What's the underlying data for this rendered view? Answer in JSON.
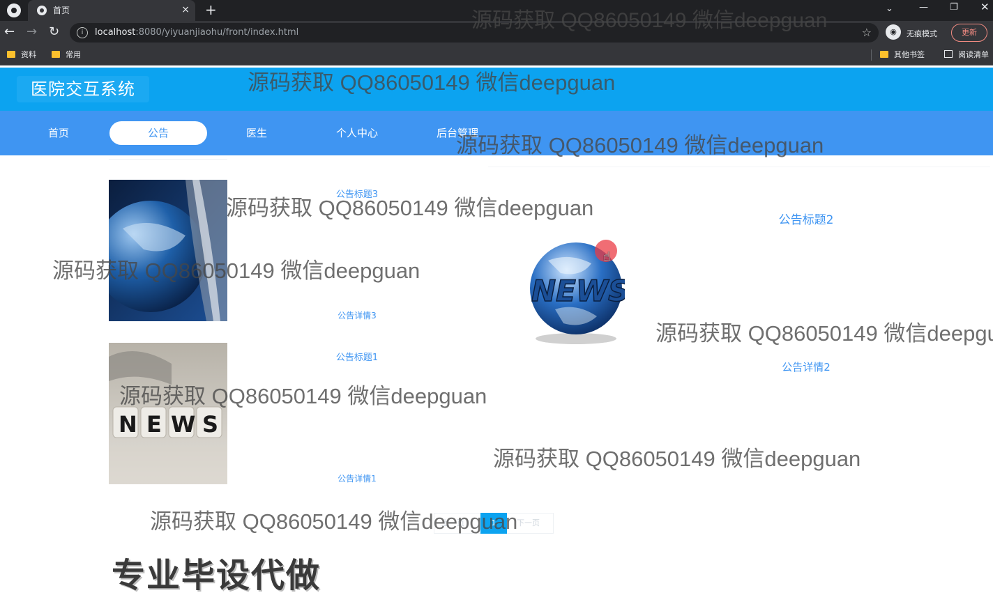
{
  "browser": {
    "tab_title": "首页",
    "tab_close": "×",
    "new_tab": "+",
    "url_host": "localhost",
    "url_rest": ":8080/yiyuanjiaohu/front/index.html",
    "incognito_label": "无痕模式",
    "update_label": "更新",
    "bookmarks": [
      "资料",
      "常用"
    ],
    "other_bookmarks": "其他书签",
    "reading_list": "阅读清单"
  },
  "site": {
    "title": "医院交互系统"
  },
  "nav": {
    "items": [
      "首页",
      "公告",
      "医生",
      "个人中心",
      "后台管理"
    ],
    "active_index": 1
  },
  "news": [
    {
      "title": "公告标题3",
      "detail": "公告详情3"
    },
    {
      "title": "公告标题2",
      "detail": "公告详情2"
    },
    {
      "title": "公告标题1",
      "detail": "公告详情1"
    }
  ],
  "pager": {
    "prev": "上一页",
    "current": "1",
    "next": "下一页"
  },
  "promo": "专业毕设代做",
  "watermark": "源码获取 QQ86050149 微信deepguan",
  "colors": {
    "header": "#0ca3f0",
    "nav": "#3f95f2",
    "link": "#3f95f2"
  }
}
